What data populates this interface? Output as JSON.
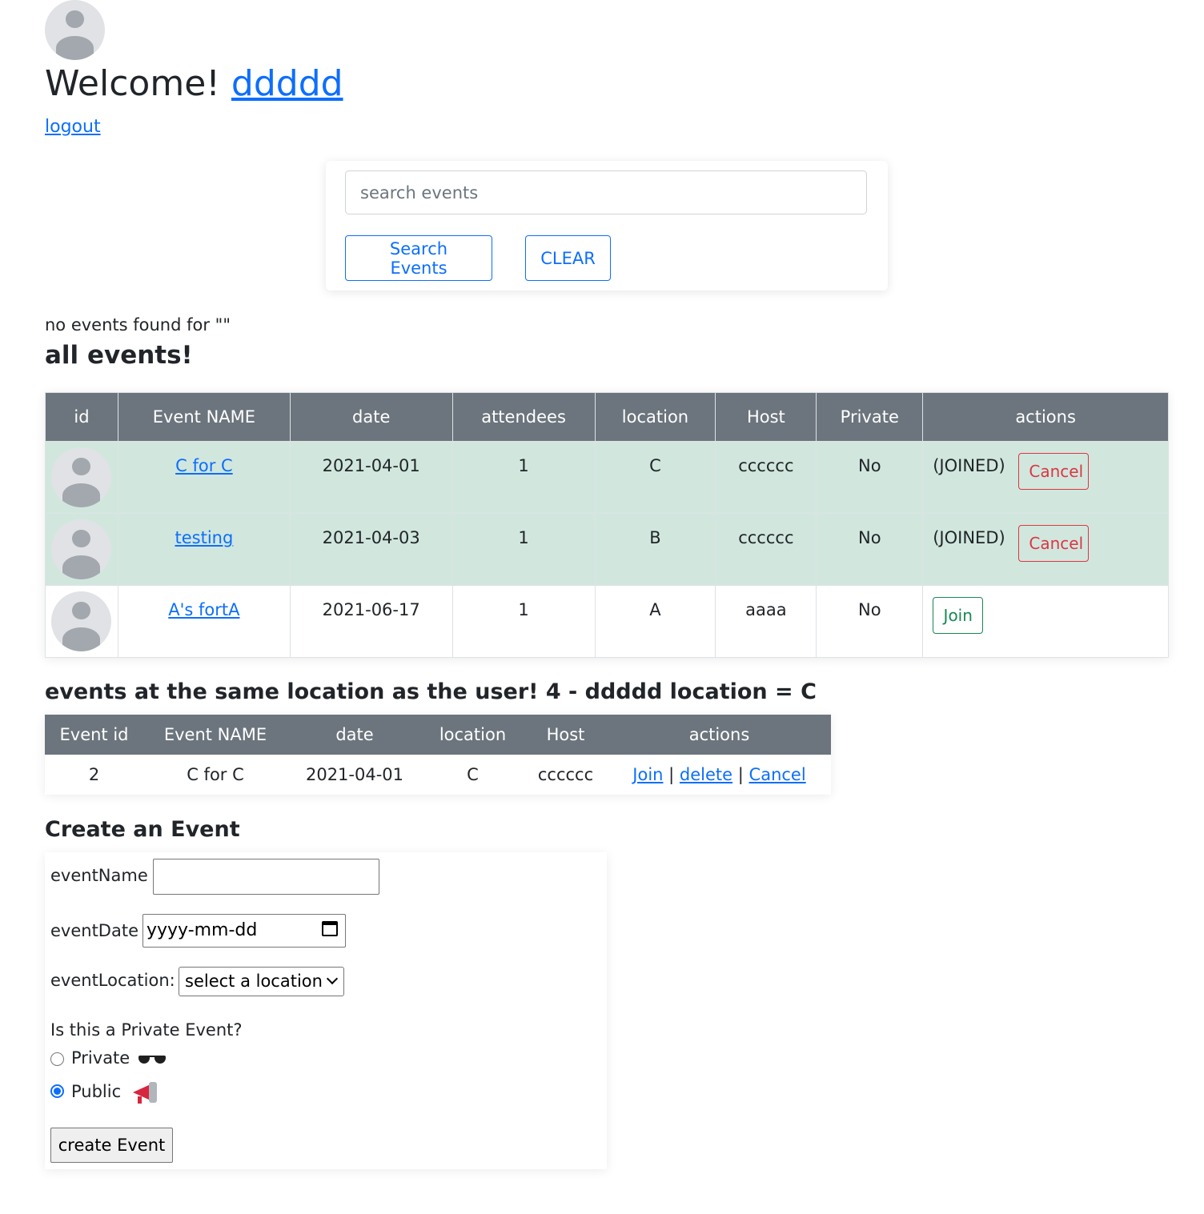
{
  "header": {
    "welcome_text": "Welcome!",
    "username": "ddddd",
    "logout_label": "logout"
  },
  "search": {
    "placeholder": "search events",
    "value": "",
    "search_button": "Search Events",
    "clear_button": "CLEAR",
    "no_results_text": "no events found for \"\""
  },
  "all_events": {
    "title": "all events!",
    "columns": [
      "id",
      "Event NAME",
      "date",
      "attendees",
      "location",
      "Host",
      "Private",
      "actions"
    ],
    "rows": [
      {
        "name": "C for C",
        "date": "2021-04-01",
        "attendees": "1",
        "location": "C",
        "host": "cccccc",
        "private": "No",
        "status": "(JOINED)",
        "action": "Cancel",
        "joined": true
      },
      {
        "name": "testing",
        "date": "2021-04-03",
        "attendees": "1",
        "location": "B",
        "host": "cccccc",
        "private": "No",
        "status": "(JOINED)",
        "action": "Cancel",
        "joined": true
      },
      {
        "name": "A's fortA",
        "date": "2021-06-17",
        "attendees": "1",
        "location": "A",
        "host": "aaaa",
        "private": "No",
        "status": "",
        "action": "Join",
        "joined": false
      }
    ]
  },
  "same_location": {
    "title": "events at the same location as the user! 4 - ddddd location = C",
    "columns": [
      "Event id",
      "Event NAME",
      "date",
      "location",
      "Host",
      "actions"
    ],
    "rows": [
      {
        "id": "2",
        "name": "C for C",
        "date": "2021-04-01",
        "location": "C",
        "host": "cccccc",
        "join": "Join",
        "delete": "delete",
        "cancel": "Cancel",
        "sep": "|"
      }
    ]
  },
  "create_event": {
    "title": "Create an Event",
    "event_name_label": "eventName",
    "event_name_value": "",
    "event_date_label": "eventDate",
    "event_date_placeholder": "yyyy-mm-dd",
    "event_location_label": "eventLocation:",
    "event_location_selected": "select a location",
    "private_question": "Is this a Private Event?",
    "private_option": "Private",
    "public_option": "Public",
    "selected_privacy": "Public",
    "submit_label": "create Event",
    "icons": {
      "private": "sunglasses-icon",
      "public": "megaphone-icon"
    }
  },
  "colors": {
    "primary": "#0d6efd",
    "danger": "#dc3545",
    "success": "#198754",
    "table_header": "#6c757d",
    "joined_row": "#d1e7dd"
  }
}
